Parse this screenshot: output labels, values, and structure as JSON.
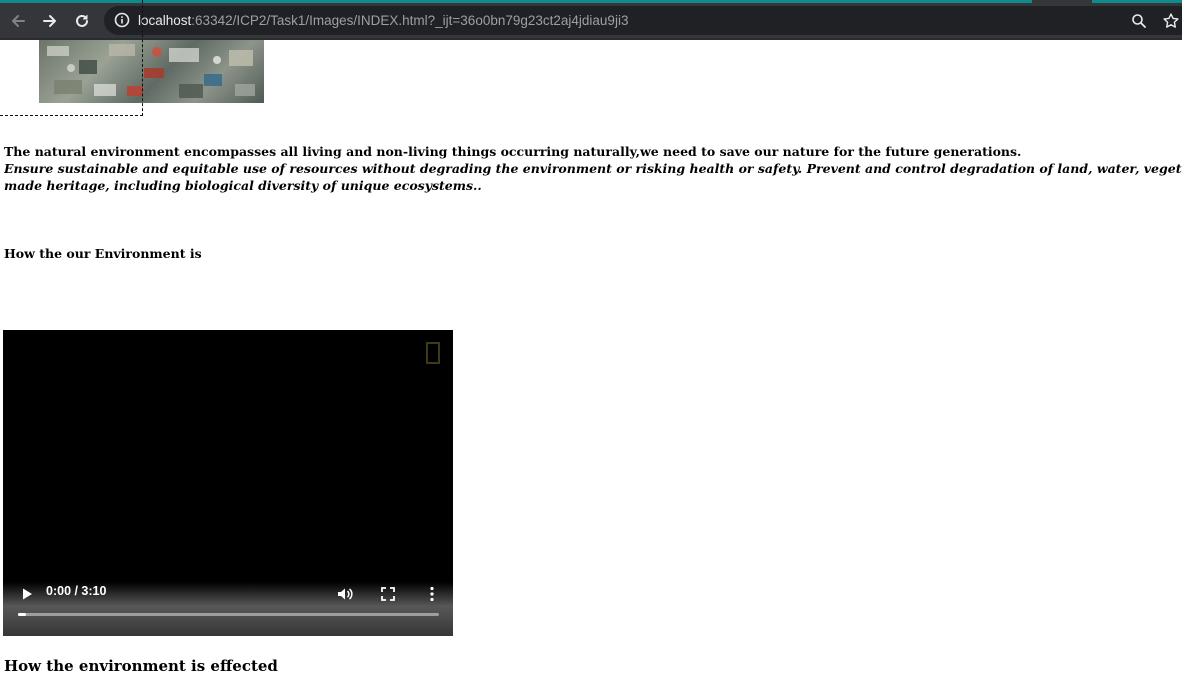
{
  "browser": {
    "url_host": "localhost",
    "url_rest": ":63342/ICP2/Task1/Images/INDEX.html?_ijt=36o0bn79g23ct2aj4jdiau9ji3"
  },
  "page": {
    "intro_bold": "The natural environment encompasses all living and non-living things occurring naturally,we need to save our nature for the future generations.",
    "intro_italic_line1": "Ensure sustainable and equitable use of resources without degrading the environment or risking health or safety. Prevent and control degradation of land, water, vegetation and air. Conserve and enhance",
    "intro_italic_line2": "made heritage, including biological diversity of unique ecosystems..",
    "heading_environment": "How the our Environment is",
    "heading_effected": "How the environment is effected"
  },
  "video": {
    "time_display": "0:00 / 3:10",
    "progress": 0.02
  }
}
